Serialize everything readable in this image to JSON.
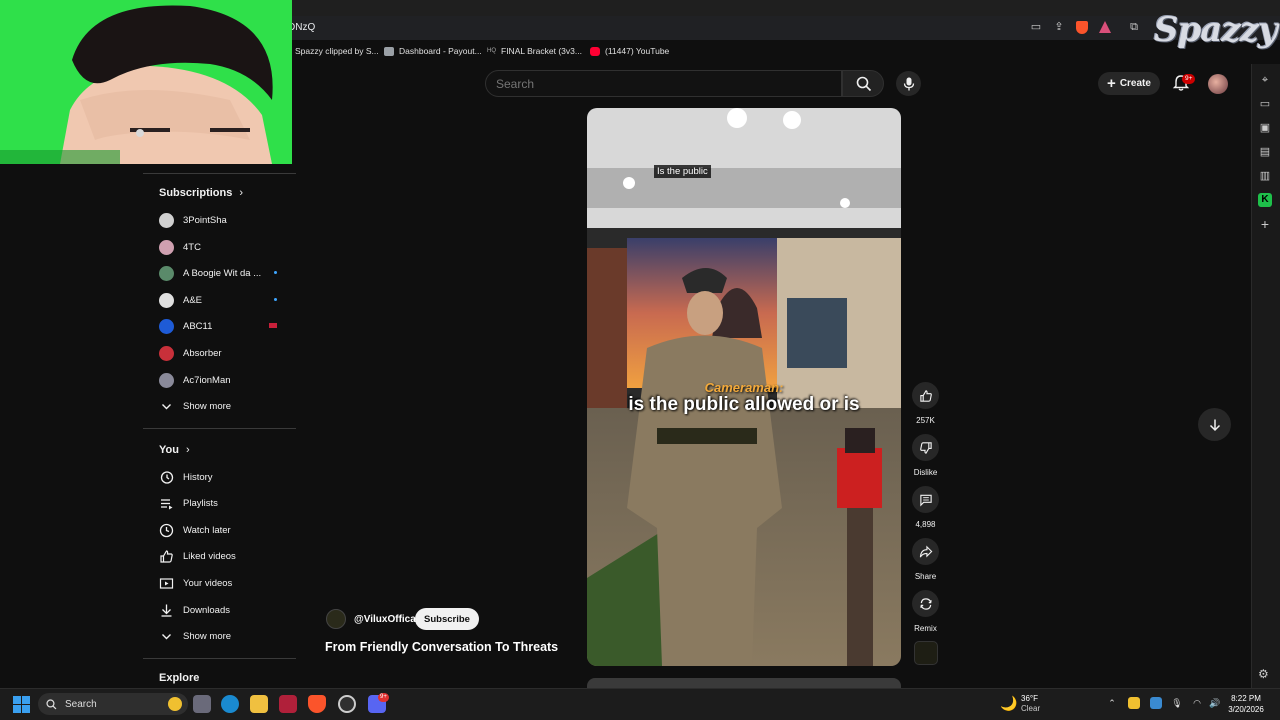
{
  "browser": {
    "url_fragment": "DNzQ",
    "bookmarks": [
      {
        "label": "Spazzy clipped by S...",
        "color": "#3a3a3a"
      },
      {
        "label": "Dashboard - Payout...",
        "color": "#9aa0a6"
      },
      {
        "label": "FINAL Bracket (3v3...",
        "color": "#5f6368"
      },
      {
        "label": "(11447) YouTube",
        "color": "#ff0033"
      }
    ]
  },
  "watermark": {
    "text": "Spazzy"
  },
  "youtube": {
    "search": {
      "placeholder": "Search"
    },
    "create_label": "Create",
    "notifications_badge": "9+",
    "subscriptions": {
      "title": "Subscriptions",
      "channels": [
        {
          "name": "3PointSha",
          "color": "#d0d0d0",
          "dot": false
        },
        {
          "name": "4TC",
          "color": "#cfa0b0",
          "dot": false
        },
        {
          "name": "A Boogie Wit da ...",
          "color": "#5a8a6a",
          "dot": true
        },
        {
          "name": "A&E",
          "color": "#e0e0e0",
          "dot": true
        },
        {
          "name": "ABC11",
          "color": "#1e5bd6",
          "dot": false
        },
        {
          "name": "Absorber",
          "color": "#c8303a",
          "dot": false
        },
        {
          "name": "Ac7ionMan",
          "color": "#8a8a9a",
          "dot": false
        }
      ],
      "show_more": "Show more"
    },
    "you": {
      "title": "You",
      "items": [
        {
          "label": "History",
          "icon": "history-icon"
        },
        {
          "label": "Playlists",
          "icon": "playlists-icon"
        },
        {
          "label": "Watch later",
          "icon": "watch-later-icon"
        },
        {
          "label": "Liked videos",
          "icon": "liked-videos-icon"
        },
        {
          "label": "Your videos",
          "icon": "your-videos-icon"
        },
        {
          "label": "Downloads",
          "icon": "downloads-icon"
        }
      ],
      "show_more": "Show more"
    },
    "explore_title": "Explore",
    "short": {
      "caption_top": "Is the public",
      "caption_speaker": "Cameraman:",
      "caption_main": "is the public allowed or is",
      "channel": "@ViluxOffical",
      "subscribe_label": "Subscribe",
      "title": "From Friendly Conversation To Threats",
      "actions": {
        "likes": "257K",
        "dislike": "Dislike",
        "comments": "4,898",
        "share": "Share",
        "remix": "Remix"
      }
    }
  },
  "taskbar": {
    "search_label": "Search",
    "weather_temp": "36°F",
    "weather_desc": "Clear",
    "time": "8:22 PM",
    "date": "3/20/2026",
    "discord_badge": "9+"
  },
  "colors": {
    "webcam_green": "#2fe04a",
    "background": "#0f0f0f",
    "accent_red": "#cc0000"
  }
}
